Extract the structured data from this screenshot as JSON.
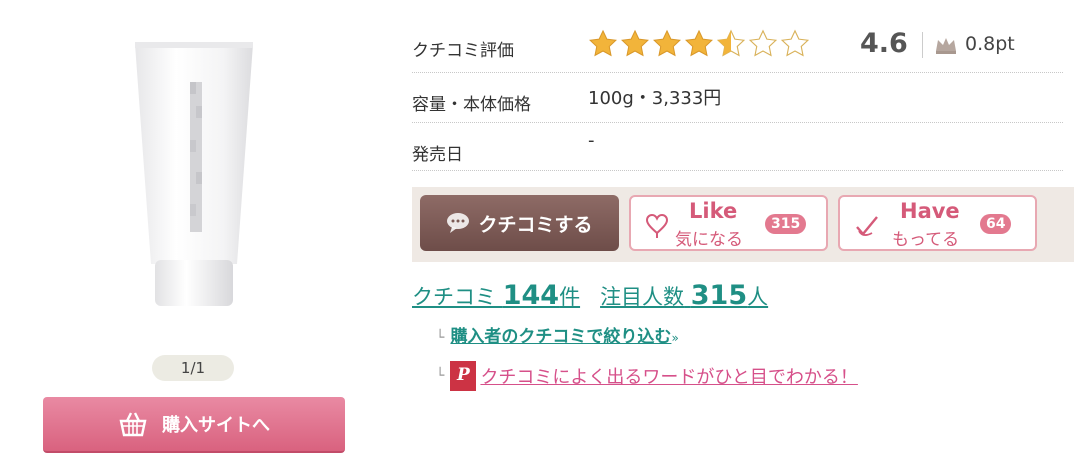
{
  "gallery": {
    "pager": "1/1"
  },
  "buy": {
    "label": "購入サイトへ"
  },
  "rating": {
    "label": "クチコミ評価",
    "stars": 4.6,
    "stars_filled_display": 4.5,
    "value": "4.6",
    "points": "0.8pt"
  },
  "info": {
    "capacity_label": "容量・本体価格",
    "capacity_value": "100g・3,333円",
    "release_label": "発売日",
    "release_value": "-"
  },
  "actions": {
    "review_label": "クチコミする",
    "like_title": "Like",
    "like_sub": "気になる",
    "like_count": "315",
    "have_title": "Have",
    "have_sub": "もってる",
    "have_count": "64"
  },
  "stats": {
    "review_label": "クチコミ",
    "review_count": "144",
    "review_unit": "件",
    "attention_label": "注目人数",
    "attention_count": "315",
    "attention_unit": "人"
  },
  "links": {
    "filter": "購入者のクチコミで絞り込む",
    "filter_arrows": "»",
    "words": "クチコミによく出るワードがひと目でわかる！",
    "p_badge": "P"
  },
  "colors": {
    "star": "#f2b43a",
    "teal": "#1f8f84",
    "pink": "#d55a79",
    "review_btn": "#7a5853"
  }
}
